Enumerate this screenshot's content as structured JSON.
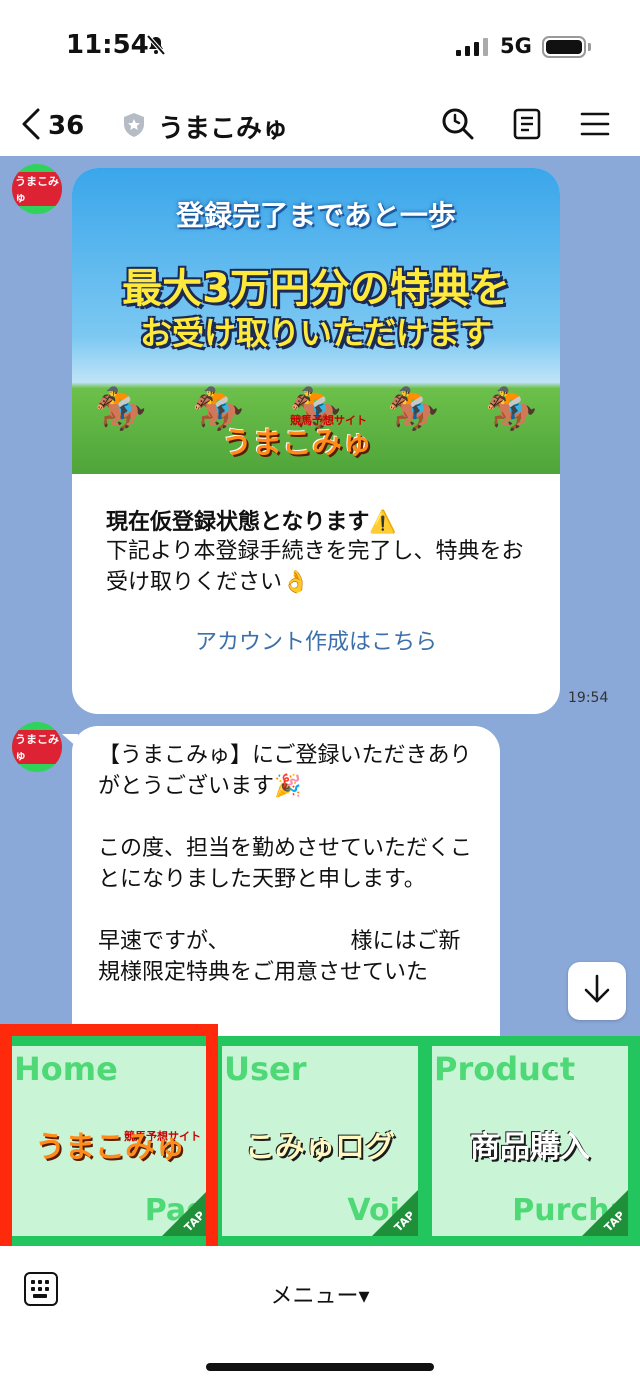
{
  "status_bar": {
    "time": "11:54",
    "network": "5G"
  },
  "header": {
    "back_count": "36",
    "title": "うまこみゅ"
  },
  "messages": {
    "card": {
      "banner_top": "登録完了まであと一歩",
      "banner_main": "最大3万円分の特典を",
      "banner_sub": "お受け取りいただけます",
      "banner_logo": "うまこみゅ",
      "banner_logo_sup": "競馬予想サイト",
      "bold_line": "現在仮登録状態となります⚠️",
      "text": "下記より本登録手続きを完了し、特典をお受け取りください👌",
      "link": "アカウント作成はこちら",
      "time": "19:54"
    },
    "bubble": {
      "text": "【うまこみゅ】にご登録いただきありがとうございます🎉\n\nこの度、担当を勤めさせていただくことになりました天野と申します。\n\n早速ですが、　　　　　　様にはご新規様限定特典をご用意させていた"
    }
  },
  "rich_menu": {
    "tiles": [
      {
        "label": "Home",
        "sub": "Page",
        "logo": "うまこみゅ",
        "logo_sup": "競馬予想サイト",
        "tap": "TAP"
      },
      {
        "label": "User",
        "sub": "Voice",
        "logo": "こみゅログ",
        "tap": "TAP"
      },
      {
        "label": "Product",
        "sub": "Purchase",
        "logo": "商品購入",
        "tap": "TAP"
      }
    ]
  },
  "bottom_bar": {
    "menu_label": "メニュー▾"
  },
  "colors": {
    "chat_bg": "#8aa8d8",
    "rich_menu_bg": "#22c55e",
    "highlight": "#ff2a0b",
    "link": "#3d6fa8"
  }
}
